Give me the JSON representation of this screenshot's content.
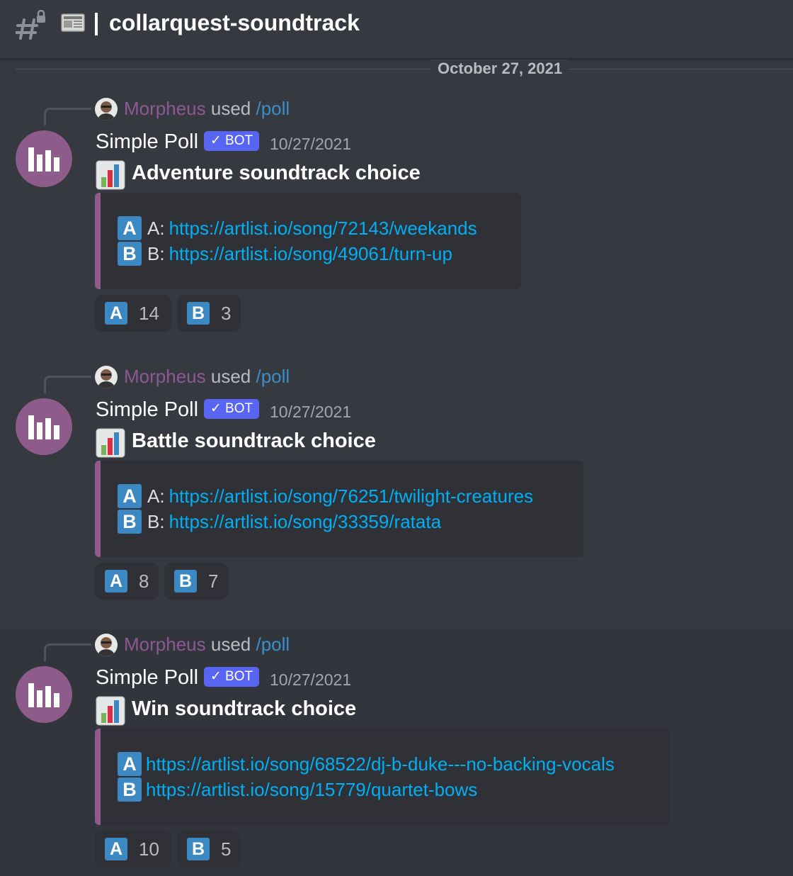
{
  "header": {
    "channel_name": "collarquest-soundtrack",
    "channel_icon": "locked-text-channel-icon",
    "category_icon": "newspaper-icon"
  },
  "date_divider": "October 27, 2021",
  "colors": {
    "background": "#36393f",
    "embed_bg": "#2f3136",
    "accent": "#8e5c8a",
    "bot_tag": "#5865f2",
    "link": "#00aff4",
    "option_badge": "#3b88c3"
  },
  "messages": [
    {
      "reply": {
        "user": "Morpheus",
        "verb": "used",
        "command": "/poll"
      },
      "author": "Simple Poll",
      "bot_tag": "✓ BOT",
      "timestamp": "10/27/2021",
      "title": "Adventure soundtrack choice",
      "options": [
        {
          "badge": "A",
          "label": "A:",
          "link": "https://artlist.io/song/72143/weekands"
        },
        {
          "badge": "B",
          "label": "B:",
          "link": "https://artlist.io/song/49061/turn-up"
        }
      ],
      "reactions": [
        {
          "emoji": "A",
          "count": "14"
        },
        {
          "emoji": "B",
          "count": "3"
        }
      ]
    },
    {
      "reply": {
        "user": "Morpheus",
        "verb": "used",
        "command": "/poll"
      },
      "author": "Simple Poll",
      "bot_tag": "✓ BOT",
      "timestamp": "10/27/2021",
      "title": "Battle soundtrack choice",
      "options": [
        {
          "badge": "A",
          "label": "A:",
          "link": "https://artlist.io/song/76251/twilight-creatures"
        },
        {
          "badge": "B",
          "label": "B:",
          "link": "https://artlist.io/song/33359/ratata"
        }
      ],
      "reactions": [
        {
          "emoji": "A",
          "count": "8"
        },
        {
          "emoji": "B",
          "count": "7"
        }
      ]
    },
    {
      "reply": {
        "user": "Morpheus",
        "verb": "used",
        "command": "/poll"
      },
      "author": "Simple Poll",
      "bot_tag": "✓ BOT",
      "timestamp": "10/27/2021",
      "title": "Win soundtrack choice",
      "options": [
        {
          "badge": "A",
          "label": "",
          "link": "https://artlist.io/song/68522/dj-b-duke---no-backing-vocals"
        },
        {
          "badge": "B",
          "label": "",
          "link": "https://artlist.io/song/15779/quartet-bows"
        }
      ],
      "reactions": [
        {
          "emoji": "A",
          "count": "10"
        },
        {
          "emoji": "B",
          "count": "5"
        }
      ]
    }
  ]
}
